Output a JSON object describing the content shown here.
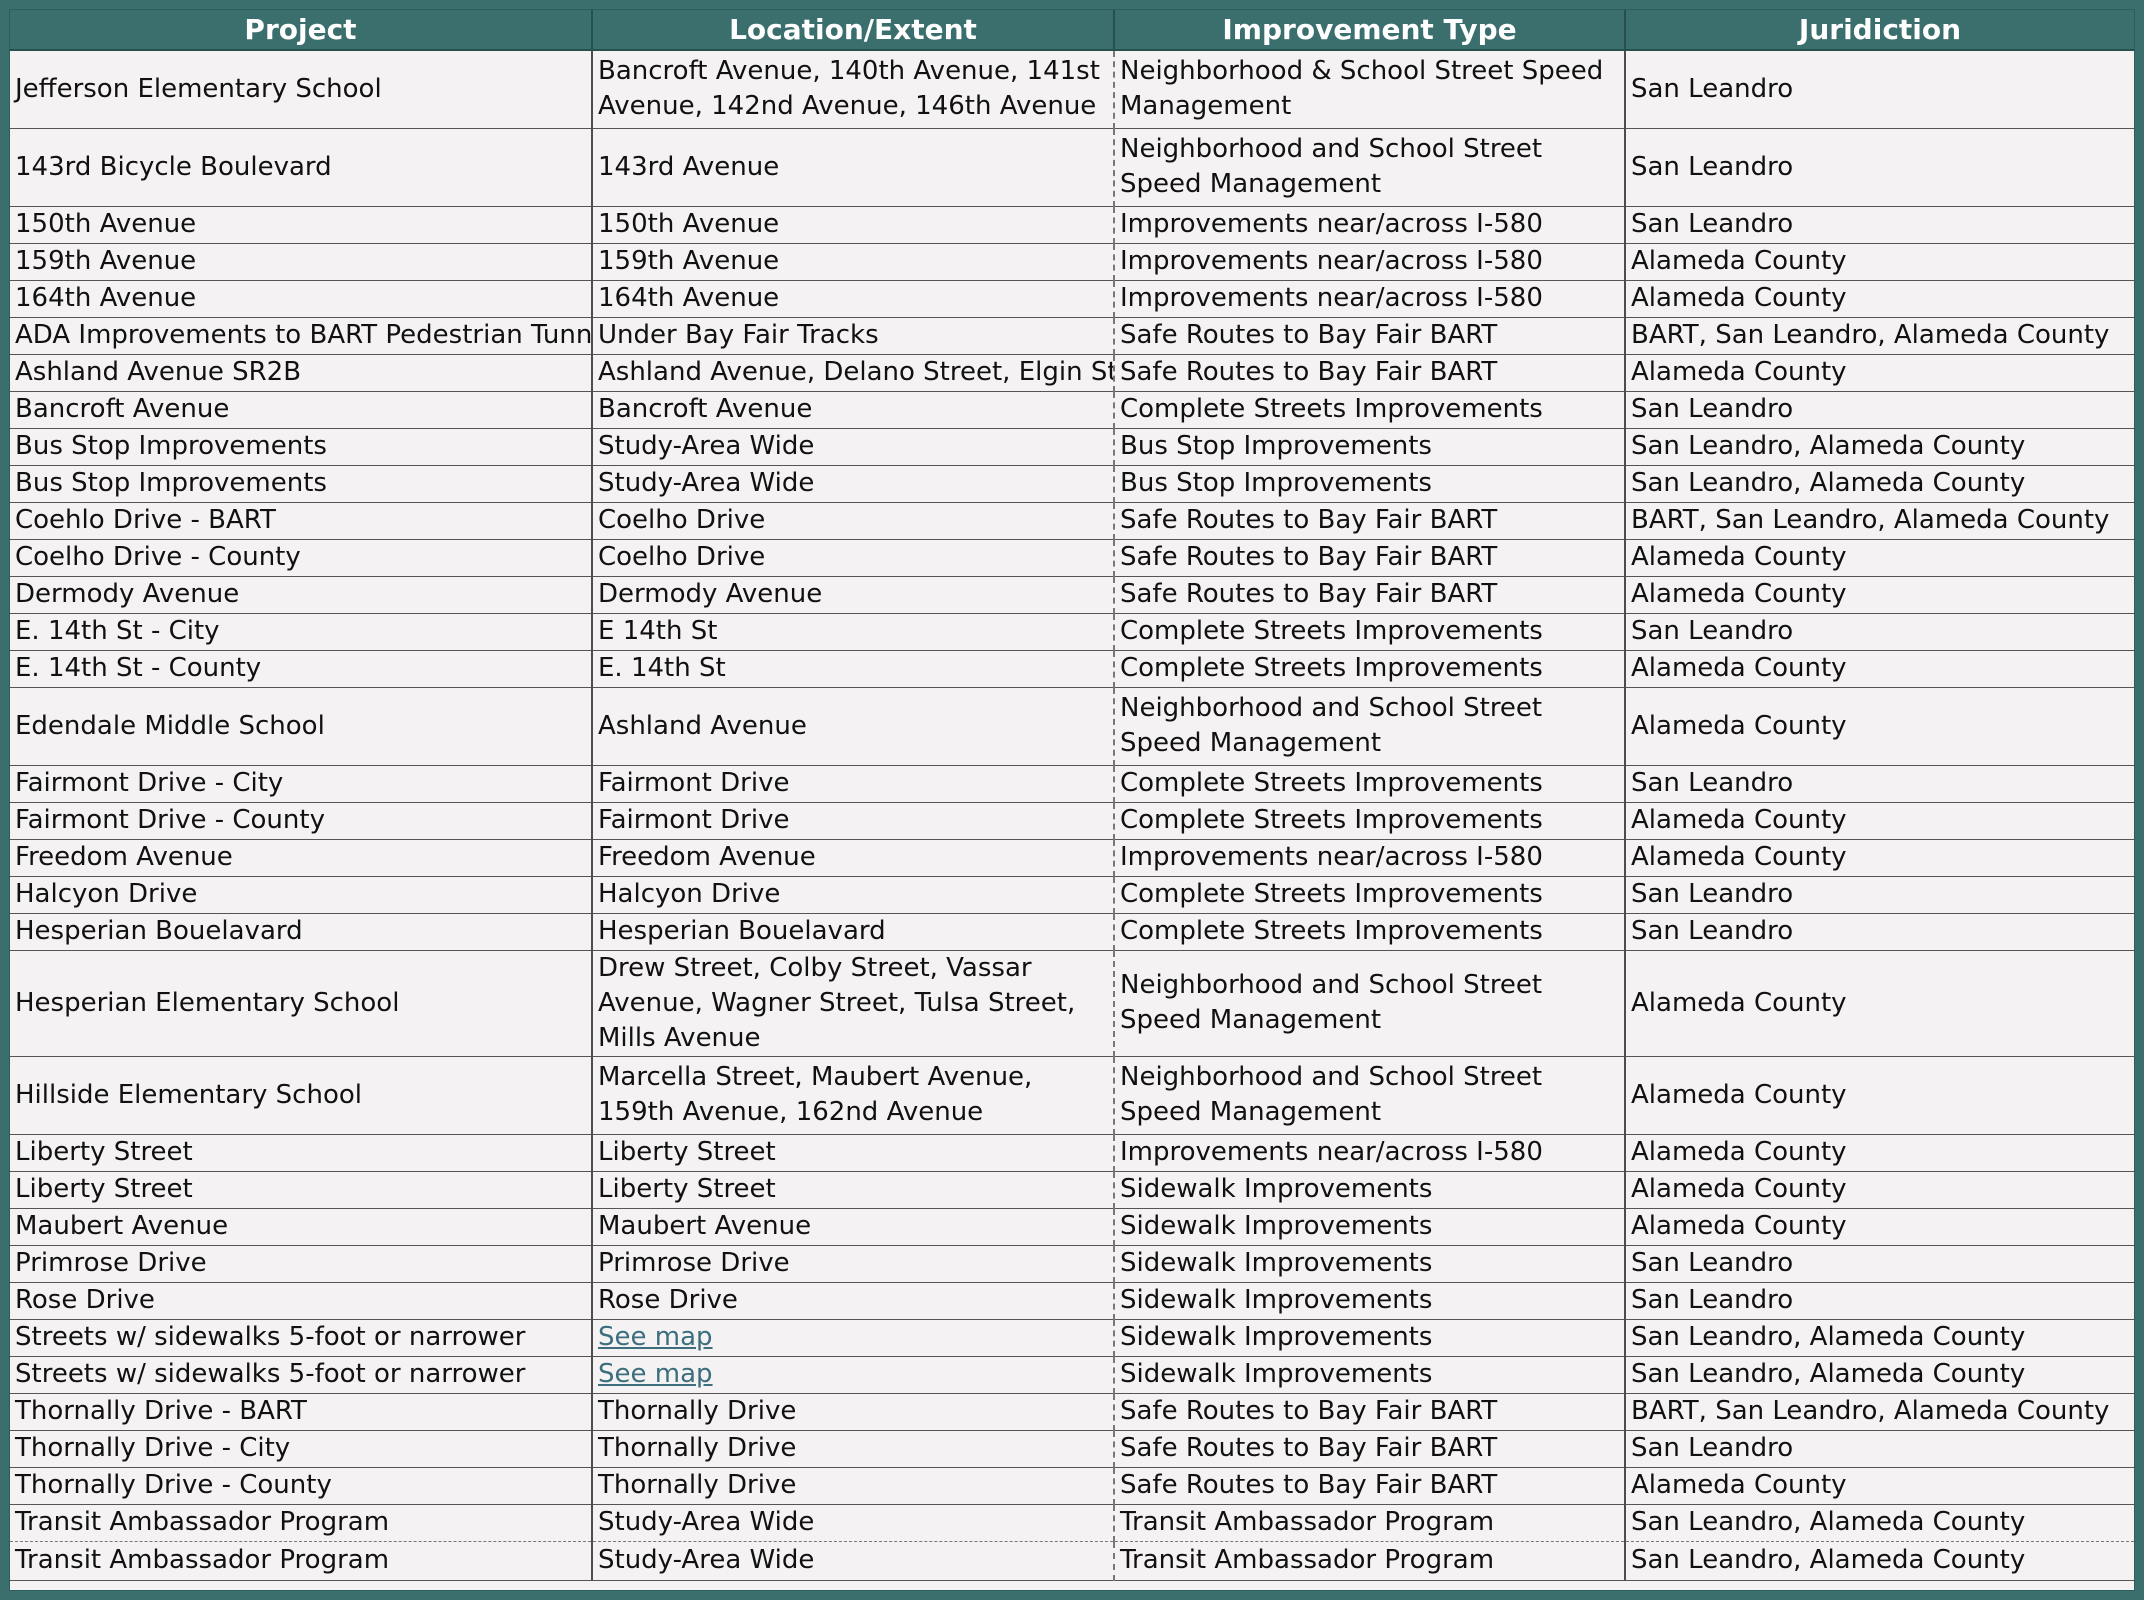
{
  "headers": [
    "Project",
    "Location/Extent",
    "Improvement Type",
    "Juridiction"
  ],
  "rows": [
    {
      "project": "Jefferson Elementary School",
      "location": "Bancroft Avenue, 140th Avenue, 141st Avenue, 142nd Avenue, 146th Avenue",
      "type": "Neighborhood & School Street Speed Management",
      "jurisdiction": "San Leandro"
    },
    {
      "project": "143rd Bicycle Boulevard",
      "location": "143rd Avenue",
      "type": "Neighborhood and School Street Speed Management",
      "jurisdiction": "San Leandro"
    },
    {
      "project": "150th Avenue",
      "location": "150th Avenue",
      "type": "Improvements near/across I-580",
      "jurisdiction": "San Leandro"
    },
    {
      "project": "159th Avenue",
      "location": "159th Avenue",
      "type": "Improvements near/across I-580",
      "jurisdiction": "Alameda County"
    },
    {
      "project": "164th Avenue",
      "location": "164th Avenue",
      "type": "Improvements near/across I-580",
      "jurisdiction": "Alameda County"
    },
    {
      "project": "ADA Improvements to BART Pedestrian Tunnel",
      "location": "Under Bay Fair Tracks",
      "type": "Safe Routes to Bay Fair BART",
      "jurisdiction": "BART, San Leandro, Alameda County"
    },
    {
      "project": "Ashland Avenue SR2B",
      "location": "Ashland Avenue, Delano Street, Elgin Street",
      "type": "Safe Routes to Bay Fair BART",
      "jurisdiction": "Alameda County"
    },
    {
      "project": "Bancroft Avenue",
      "location": "Bancroft Avenue",
      "type": "Complete Streets Improvements",
      "jurisdiction": "San Leandro"
    },
    {
      "project": "Bus Stop Improvements",
      "location": "Study-Area Wide",
      "type": "Bus Stop Improvements",
      "jurisdiction": "San Leandro, Alameda County"
    },
    {
      "project": "Bus Stop Improvements",
      "location": "Study-Area Wide",
      "type": "Bus Stop Improvements",
      "jurisdiction": "San Leandro, Alameda County"
    },
    {
      "project": "Coehlo Drive - BART",
      "location": "Coelho Drive",
      "type": "Safe Routes to Bay Fair BART",
      "jurisdiction": "BART, San Leandro, Alameda County"
    },
    {
      "project": "Coelho Drive - County",
      "location": "Coelho Drive",
      "type": "Safe Routes to Bay Fair BART",
      "jurisdiction": "Alameda County"
    },
    {
      "project": "Dermody Avenue",
      "location": "Dermody Avenue",
      "type": "Safe Routes to Bay Fair BART",
      "jurisdiction": "Alameda County"
    },
    {
      "project": "E. 14th St - City",
      "location": "E 14th St",
      "type": "Complete Streets Improvements",
      "jurisdiction": "San Leandro"
    },
    {
      "project": "E. 14th St - County",
      "location": "E. 14th St",
      "type": "Complete Streets Improvements",
      "jurisdiction": "Alameda County"
    },
    {
      "project": "Edendale Middle School",
      "location": "Ashland Avenue",
      "type": "Neighborhood and School Street Speed Management",
      "jurisdiction": "Alameda County"
    },
    {
      "project": "Fairmont Drive - City",
      "location": "Fairmont Drive",
      "type": "Complete Streets Improvements",
      "jurisdiction": "San Leandro"
    },
    {
      "project": "Fairmont Drive - County",
      "location": "Fairmont Drive",
      "type": "Complete Streets Improvements",
      "jurisdiction": "Alameda County"
    },
    {
      "project": "Freedom Avenue",
      "location": "Freedom Avenue",
      "type": "Improvements near/across I-580",
      "jurisdiction": "Alameda County"
    },
    {
      "project": "Halcyon Drive",
      "location": "Halcyon Drive",
      "type": "Complete Streets Improvements",
      "jurisdiction": "San Leandro"
    },
    {
      "project": "Hesperian Bouelavard",
      "location": "Hesperian Bouelavard",
      "type": "Complete Streets Improvements",
      "jurisdiction": "San Leandro"
    },
    {
      "project": "Hesperian Elementary School",
      "location": "Drew Street, Colby Street, Vassar Avenue, Wagner Street, Tulsa Street, Mills Avenue",
      "type": "Neighborhood and School Street Speed Management",
      "jurisdiction": "Alameda County"
    },
    {
      "project": "Hillside Elementary School",
      "location": "Marcella Street, Maubert Avenue, 159th Avenue, 162nd Avenue",
      "type": "Neighborhood and School Street Speed Management",
      "jurisdiction": "Alameda County"
    },
    {
      "project": "Liberty Street",
      "location": "Liberty Street",
      "type": "Improvements near/across I-580",
      "jurisdiction": "Alameda County"
    },
    {
      "project": "Liberty Street",
      "location": "Liberty Street",
      "type": "Sidewalk Improvements",
      "jurisdiction": "Alameda County"
    },
    {
      "project": "Maubert Avenue",
      "location": "Maubert Avenue",
      "type": "Sidewalk Improvements",
      "jurisdiction": "Alameda County"
    },
    {
      "project": "Primrose Drive",
      "location": "Primrose Drive",
      "type": "Sidewalk Improvements",
      "jurisdiction": "San Leandro"
    },
    {
      "project": "Rose Drive",
      "location": "Rose Drive",
      "type": "Sidewalk Improvements",
      "jurisdiction": "San Leandro"
    },
    {
      "project": "Streets w/ sidewalks 5-foot or narrower",
      "location": "See map",
      "type": "Sidewalk Improvements",
      "jurisdiction": "San Leandro, Alameda County"
    },
    {
      "project": "Streets w/ sidewalks 5-foot or narrower",
      "location": "See map",
      "type": "Sidewalk Improvements",
      "jurisdiction": "San Leandro, Alameda County"
    },
    {
      "project": "Thornally Drive - BART",
      "location": "Thornally Drive",
      "type": "Safe Routes to Bay Fair BART",
      "jurisdiction": "BART, San Leandro, Alameda County"
    },
    {
      "project": "Thornally Drive - City",
      "location": "Thornally Drive",
      "type": "Safe Routes to Bay Fair BART",
      "jurisdiction": "San Leandro"
    },
    {
      "project": "Thornally Drive - County",
      "location": "Thornally Drive",
      "type": "Safe Routes to Bay Fair BART",
      "jurisdiction": "Alameda County"
    },
    {
      "project": "Transit Ambassador Program",
      "location": "Study-Area Wide",
      "type": "Transit Ambassador Program",
      "jurisdiction": "San Leandro, Alameda County"
    },
    {
      "project": "Transit Ambassador Program",
      "location": "Study-Area Wide",
      "type": "Transit Ambassador Program",
      "jurisdiction": "San Leandro, Alameda County"
    }
  ],
  "link_rows": [
    28,
    29
  ],
  "double_rows": [
    0,
    1,
    15,
    21,
    22
  ],
  "colors": {
    "header_bg": "#3a6f6d",
    "header_text": "#ffffff",
    "sheet_bg": "#f4f2f2",
    "link": "#3c6e7e"
  }
}
